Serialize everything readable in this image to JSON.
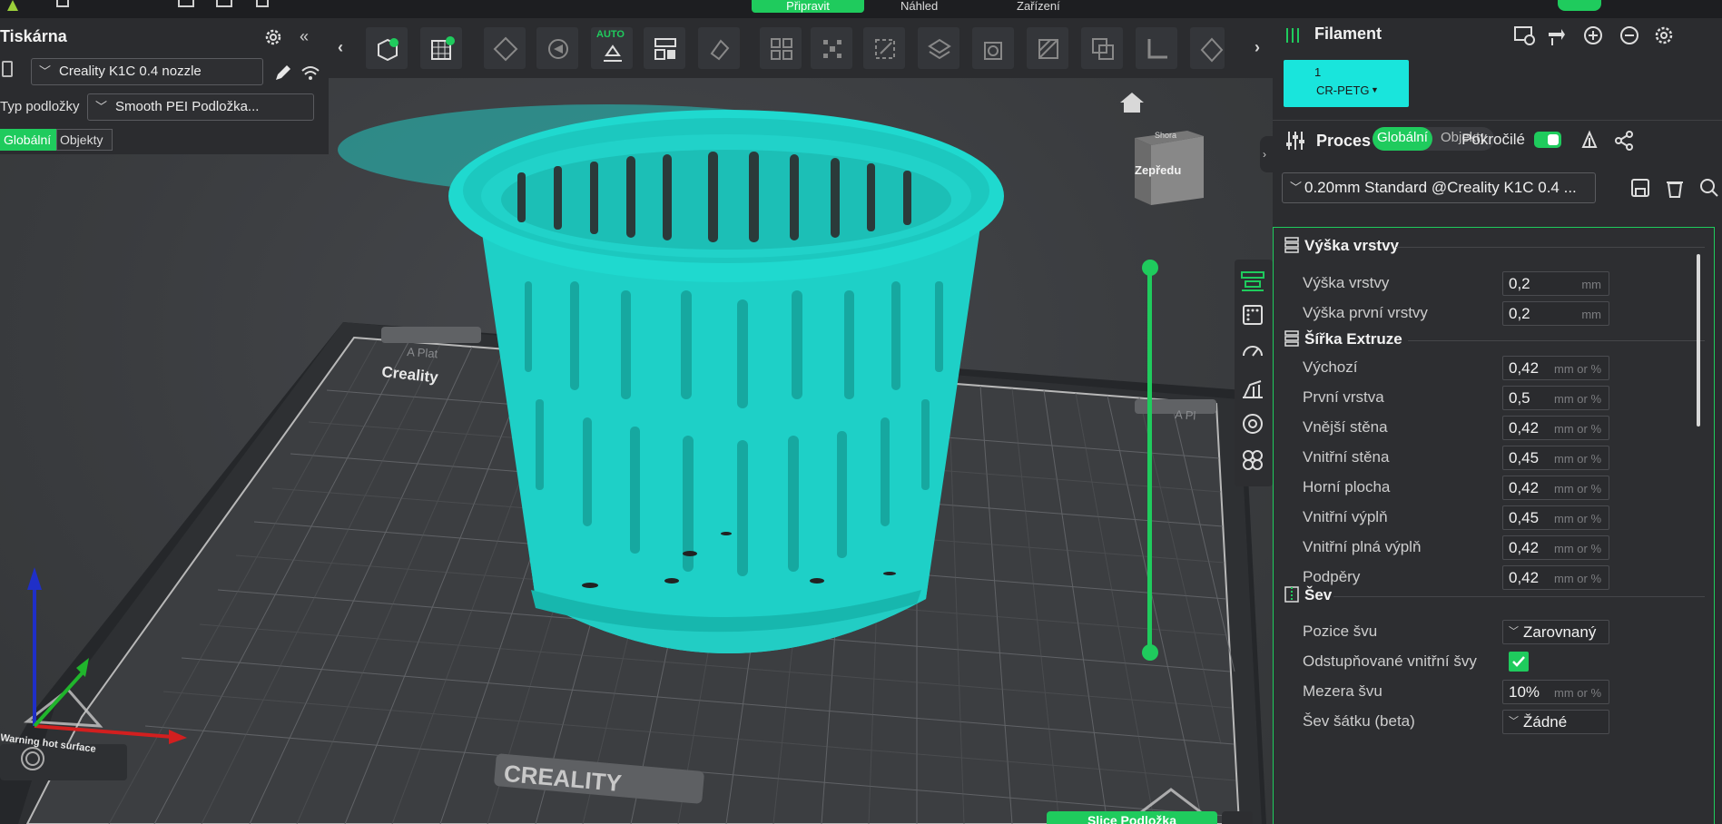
{
  "topbar": {
    "tabs": [
      {
        "label": "Připravit",
        "active": true
      },
      {
        "label": "Náhled",
        "active": false
      },
      {
        "label": "Zařízení",
        "active": false
      }
    ]
  },
  "printer": {
    "title": "Tiskárna",
    "printer_name": "Creality K1C 0.4 nozzle",
    "bed_type_label": "Typ podložky",
    "bed_type_value": "Smooth PEI Podložka...",
    "scope_global": "Globální",
    "scope_objects": "Objekty"
  },
  "toolbar": {
    "auto_badge": "AUTO",
    "buttons": [
      "add-object",
      "add-plate",
      "arrange",
      "orient",
      "auto-arrange",
      "layout",
      "paint",
      "split",
      "variable-layer",
      "scale",
      "cut",
      "hollow",
      "seam-paint",
      "boolean",
      "measure",
      "support-paint"
    ]
  },
  "right_panel": {
    "filament_title": "Filament",
    "filament_slot": "1",
    "filament_name": "CR-PETG",
    "filament_color": "#19e5dc",
    "process_title": "Proces",
    "process_global": "Globální",
    "process_objects": "Objekty",
    "advanced_label": "Pokročilé",
    "preset": "0.20mm Standard @Creality K1C 0.4 ..."
  },
  "settings": {
    "layer_section": "Výška vrstvy",
    "layer_rows": [
      {
        "label": "Výška vrstvy",
        "value": "0,2",
        "unit": "mm"
      },
      {
        "label": "Výška první vrstvy",
        "value": "0,2",
        "unit": "mm"
      }
    ],
    "width_section": "Šířka Extruze",
    "width_rows": [
      {
        "label": "Výchozí",
        "value": "0,42",
        "unit": "mm or %"
      },
      {
        "label": "První vrstva",
        "value": "0,5",
        "unit": "mm or %"
      },
      {
        "label": "Vnější stěna",
        "value": "0,42",
        "unit": "mm or %"
      },
      {
        "label": "Vnitřní stěna",
        "value": "0,45",
        "unit": "mm or %"
      },
      {
        "label": "Horní plocha",
        "value": "0,42",
        "unit": "mm or %"
      },
      {
        "label": "Vnitřní výplň",
        "value": "0,45",
        "unit": "mm or %"
      },
      {
        "label": "Vnitřní plná výplň",
        "value": "0,42",
        "unit": "mm or %"
      },
      {
        "label": "Podpěry",
        "value": "0,42",
        "unit": "mm or %"
      }
    ],
    "seam_section": "Šev",
    "seam_position_label": "Pozice švu",
    "seam_position_value": "Zarovnaný",
    "staggered_label": "Odstupňované vnitřní švy",
    "staggered_checked": true,
    "seam_gap_label": "Mezera švu",
    "seam_gap_value": "10%",
    "seam_gap_unit": "mm or %",
    "scarf_label": "Šev šátku (beta)",
    "scarf_value": "Žádné"
  },
  "viewport": {
    "cube_top": "Shora",
    "cube_front": "Zepředu",
    "bed_brand": "CREALITY",
    "bed_brand_small": "Creality",
    "bed_warning": "Warning hot surface",
    "plate_label": "A Plat",
    "plate_label_right": "A Pl",
    "object_color": "#1fd4cb",
    "slice_button": "Slice Podložka"
  }
}
